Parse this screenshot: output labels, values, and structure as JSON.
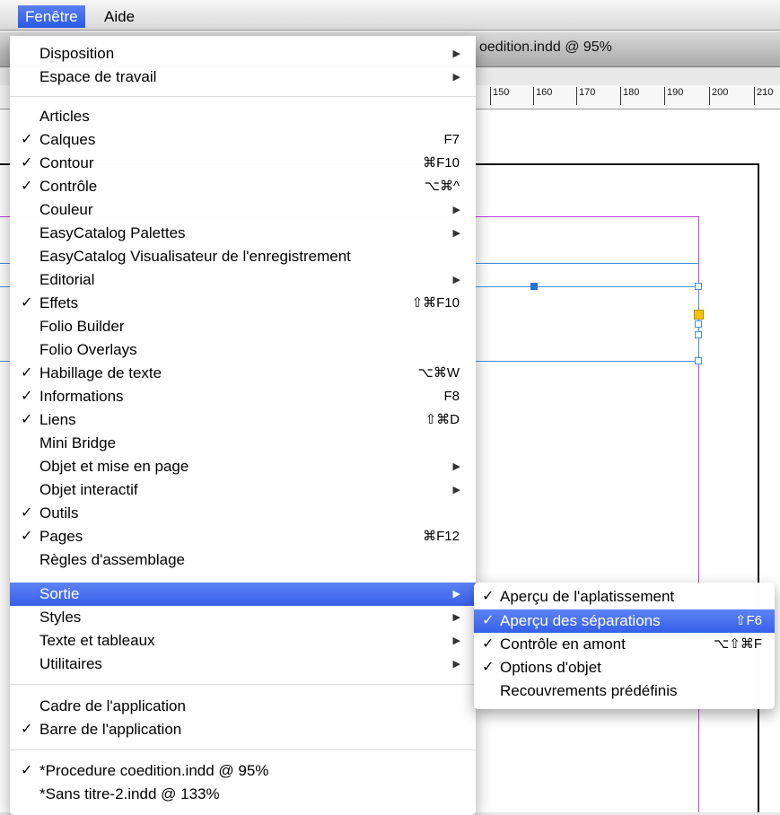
{
  "menubar": {
    "fenetre": "Fenêtre",
    "aide": "Aide"
  },
  "document": {
    "title_fragment": "oedition.indd @ 95%",
    "ruler_ticks": [
      "150",
      "160",
      "170",
      "180",
      "190",
      "200",
      "210"
    ]
  },
  "menu": {
    "items": [
      {
        "check": "",
        "label": "Disposition",
        "shortcut": "",
        "arrow": "▶"
      },
      {
        "check": "",
        "label": "Espace de travail",
        "shortcut": "",
        "arrow": "▶"
      },
      {
        "check": "",
        "label": "Articles",
        "shortcut": "",
        "arrow": ""
      },
      {
        "check": "✓",
        "label": "Calques",
        "shortcut": "F7",
        "arrow": ""
      },
      {
        "check": "✓",
        "label": "Contour",
        "shortcut": "⌘F10",
        "arrow": ""
      },
      {
        "check": "✓",
        "label": "Contrôle",
        "shortcut": "⌥⌘^",
        "arrow": ""
      },
      {
        "check": "",
        "label": "Couleur",
        "shortcut": "",
        "arrow": "▶"
      },
      {
        "check": "",
        "label": "EasyCatalog Palettes",
        "shortcut": "",
        "arrow": "▶"
      },
      {
        "check": "",
        "label": "EasyCatalog Visualisateur de l'enregistrement",
        "shortcut": "",
        "arrow": ""
      },
      {
        "check": "",
        "label": "Editorial",
        "shortcut": "",
        "arrow": "▶"
      },
      {
        "check": "✓",
        "label": "Effets",
        "shortcut": "⇧⌘F10",
        "arrow": ""
      },
      {
        "check": "",
        "label": "Folio Builder",
        "shortcut": "",
        "arrow": ""
      },
      {
        "check": "",
        "label": "Folio Overlays",
        "shortcut": "",
        "arrow": ""
      },
      {
        "check": "✓",
        "label": "Habillage de texte",
        "shortcut": "⌥⌘W",
        "arrow": ""
      },
      {
        "check": "✓",
        "label": "Informations",
        "shortcut": "F8",
        "arrow": ""
      },
      {
        "check": "✓",
        "label": "Liens",
        "shortcut": "⇧⌘D",
        "arrow": ""
      },
      {
        "check": "",
        "label": "Mini Bridge",
        "shortcut": "",
        "arrow": ""
      },
      {
        "check": "",
        "label": "Objet et mise en page",
        "shortcut": "",
        "arrow": "▶"
      },
      {
        "check": "",
        "label": "Objet interactif",
        "shortcut": "",
        "arrow": "▶"
      },
      {
        "check": "✓",
        "label": "Outils",
        "shortcut": "",
        "arrow": ""
      },
      {
        "check": "✓",
        "label": "Pages",
        "shortcut": "⌘F12",
        "arrow": ""
      },
      {
        "check": "",
        "label": "Règles d'assemblage",
        "shortcut": "",
        "arrow": ""
      },
      {
        "check": "",
        "label": "Sortie",
        "shortcut": "",
        "arrow": "▶"
      },
      {
        "check": "",
        "label": "Styles",
        "shortcut": "",
        "arrow": "▶"
      },
      {
        "check": "",
        "label": "Texte et tableaux",
        "shortcut": "",
        "arrow": "▶"
      },
      {
        "check": "",
        "label": "Utilitaires",
        "shortcut": "",
        "arrow": "▶"
      },
      {
        "check": "",
        "label": "Cadre de l'application",
        "shortcut": "",
        "arrow": ""
      },
      {
        "check": "✓",
        "label": "Barre de l'application",
        "shortcut": "",
        "arrow": ""
      },
      {
        "check": "✓",
        "label": "*Procedure coedition.indd @ 95%",
        "shortcut": "",
        "arrow": ""
      },
      {
        "check": "",
        "label": "*Sans titre-2.indd @ 133%",
        "shortcut": "",
        "arrow": ""
      }
    ]
  },
  "submenu": {
    "items": [
      {
        "check": "✓",
        "label": "Aperçu de l'aplatissement",
        "shortcut": ""
      },
      {
        "check": "✓",
        "label": "Aperçu des séparations",
        "shortcut": "⇧F6"
      },
      {
        "check": "✓",
        "label": "Contrôle en amont",
        "shortcut": "⌥⇧⌘F"
      },
      {
        "check": "✓",
        "label": "Options d'objet",
        "shortcut": ""
      },
      {
        "check": "",
        "label": "Recouvrements prédéfinis",
        "shortcut": ""
      }
    ]
  }
}
